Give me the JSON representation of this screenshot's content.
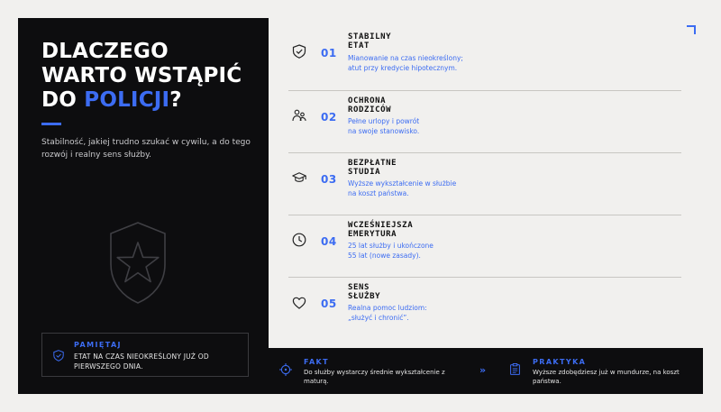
{
  "hero": {
    "title_line1": "DLACZEGO",
    "title_line2": "WARTO WSTĄPIĆ",
    "title_line3_prefix": "DO ",
    "title_line3_accent": "POLICJI",
    "title_line3_suffix": "?",
    "subtitle": "Stabilność, jakiej trudno szukać w cywilu, a do tego rozwój i realny sens służby."
  },
  "note": {
    "label": "PAMIĘTAJ",
    "text": "ETAT NA CZAS NIEOKREŚLONY JUŻ OD PIERWSZEGO DNIA."
  },
  "benefits": [
    {
      "number": "01",
      "title_line1": "STABILNY",
      "title_line2": "ETAT",
      "desc_line1": "Mianowanie na czas nieokreślony;",
      "desc_line2": "atut przy kredycie hipotecznym.",
      "icon": "shield-check-icon"
    },
    {
      "number": "02",
      "title_line1": "OCHRONA",
      "title_line2": "RODZICÓW",
      "desc_line1": "Pełne urlopy i powrót",
      "desc_line2": "na swoje stanowisko.",
      "icon": "family-icon"
    },
    {
      "number": "03",
      "title_line1": "BEZPŁATNE",
      "title_line2": "STUDIA",
      "desc_line1": "Wyższe wykształcenie w służbie",
      "desc_line2": "na koszt państwa.",
      "icon": "graduation-cap-icon"
    },
    {
      "number": "04",
      "title_line1": "WCZEŚNIEJSZA",
      "title_line2": "EMERYTURA",
      "desc_line1": "25 lat służby i ukończone",
      "desc_line2": "55 lat (nowe zasady).",
      "icon": "clock-icon"
    },
    {
      "number": "05",
      "title_line1": "SENS",
      "title_line2": "SŁUŻBY",
      "desc_line1": "Realna pomoc ludziom:",
      "desc_line2": "„służyć i chronić”.",
      "icon": "heart-icon"
    }
  ],
  "fact": {
    "label": "FAKT",
    "text": "Do służby wystarczy średnie wykształcenie z maturą."
  },
  "separator": "»",
  "practice": {
    "label": "PRAKTYKA",
    "text": "Wyższe zdobędziesz już w mundurze, na koszt państwa."
  },
  "colors": {
    "accent": "#3c6cf2",
    "dark": "#0d0d0f",
    "light": "#f1f0ee"
  }
}
